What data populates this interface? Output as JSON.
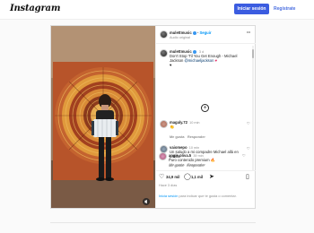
{
  "header": {
    "logo": "Instagram",
    "login_label": "Iniciar sesión",
    "register_label": "Regístrate"
  },
  "post": {
    "author": "mulettmusic",
    "follow_label": "Seguir",
    "audio": "Audio original",
    "caption_author": "mulettmusic",
    "caption_time": "3 d",
    "caption_text": "Don't Stop 'Til You Get Enough - Michael Jackson",
    "caption_mention": "@michaeljackson",
    "comments": [
      {
        "user": "magaly.72",
        "time": "10 min",
        "text": "👏",
        "likes": "Me gusta",
        "reply": "Responder"
      },
      {
        "user": "vaiomepo",
        "time": "10 min",
        "text": "Un saludo a mi compadre Michael allá en patillal",
        "likes": "Me gusta",
        "reply": "Responder"
      },
      {
        "user": "angie.oliva.5",
        "time": "39 min",
        "text": "Puro contenido premium 🔥",
        "likes": "Me gusta",
        "reply": "Responder"
      }
    ],
    "like_count": "34,9 mil",
    "comment_count": "1,1 mil",
    "posted": "Hace 3 días",
    "login_prompt_link": "Inicia sesión",
    "login_prompt_text": "para indicar que te gusta o comentar."
  },
  "colors": {
    "accent": "#3b5ce0",
    "link": "#00376b"
  }
}
